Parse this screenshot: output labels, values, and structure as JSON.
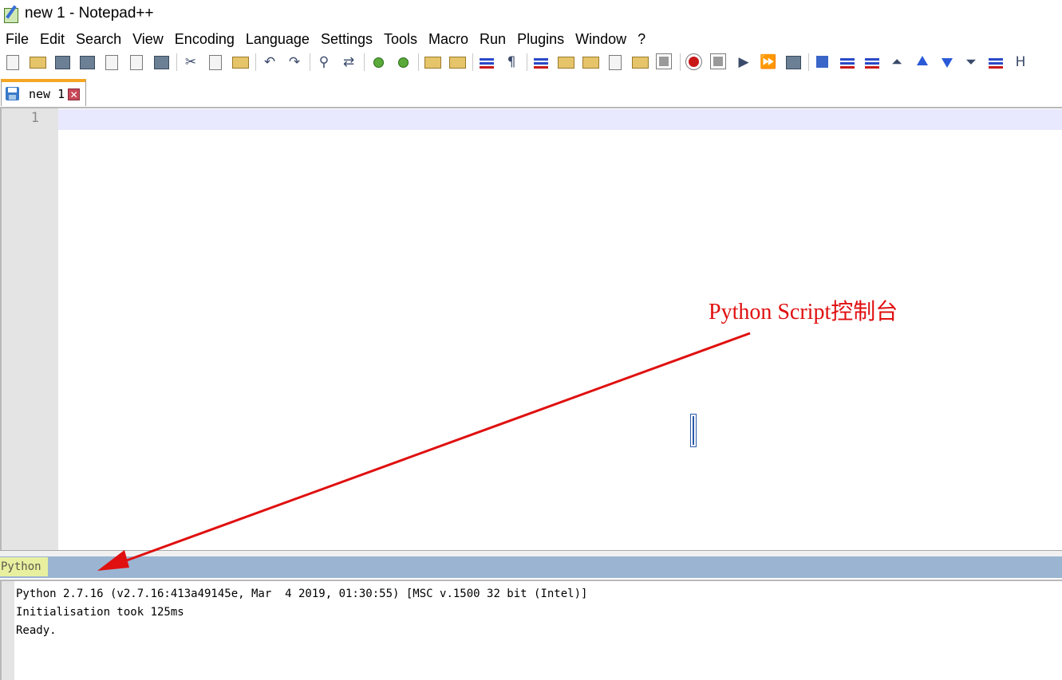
{
  "window": {
    "title": "new 1 - Notepad++"
  },
  "menu": [
    "File",
    "Edit",
    "Search",
    "View",
    "Encoding",
    "Language",
    "Settings",
    "Tools",
    "Macro",
    "Run",
    "Plugins",
    "Window",
    "?"
  ],
  "toolbar": {
    "buttons": [
      {
        "name": "new-file-icon",
        "style": "a",
        "group": 1
      },
      {
        "name": "open-file-icon",
        "style": "c",
        "group": 1
      },
      {
        "name": "save-icon",
        "style": "b",
        "group": 1
      },
      {
        "name": "save-all-icon",
        "style": "b",
        "group": 1
      },
      {
        "name": "close-icon",
        "style": "a",
        "group": 1
      },
      {
        "name": "close-all-icon",
        "style": "a",
        "group": 1
      },
      {
        "name": "print-icon",
        "style": "b",
        "group": 1
      },
      {
        "name": "cut-icon",
        "glyph": "✂",
        "group": 2
      },
      {
        "name": "copy-icon",
        "style": "a",
        "group": 2
      },
      {
        "name": "paste-icon",
        "style": "c",
        "group": 2
      },
      {
        "name": "undo-icon",
        "glyph": "↶",
        "group": 3
      },
      {
        "name": "redo-icon",
        "glyph": "↷",
        "group": 3
      },
      {
        "name": "find-icon",
        "glyph": "⚲",
        "group": 4
      },
      {
        "name": "replace-icon",
        "glyph": "⇄",
        "group": 4
      },
      {
        "name": "zoom-in-icon",
        "style": "d",
        "group": 5
      },
      {
        "name": "zoom-out-icon",
        "style": "d",
        "group": 5
      },
      {
        "name": "sync-vertical-icon",
        "style": "c",
        "group": 6
      },
      {
        "name": "sync-horizontal-icon",
        "style": "c",
        "group": 6
      },
      {
        "name": "word-wrap-icon",
        "style": "h",
        "group": 7
      },
      {
        "name": "show-all-chars-icon",
        "glyph": "¶",
        "group": 7
      },
      {
        "name": "indent-guide-icon",
        "style": "h",
        "group": 8
      },
      {
        "name": "user-language-icon",
        "style": "c",
        "group": 8
      },
      {
        "name": "document-map-icon",
        "style": "c",
        "group": 8
      },
      {
        "name": "function-list-icon",
        "style": "a",
        "group": 8
      },
      {
        "name": "folder-as-workspace-icon",
        "style": "c",
        "group": 8
      },
      {
        "name": "monitoring-icon",
        "style": "g",
        "group": 8
      },
      {
        "name": "record-macro-icon",
        "style": "f",
        "group": 9
      },
      {
        "name": "stop-recording-icon",
        "style": "g",
        "group": 9
      },
      {
        "name": "playback-macro-icon",
        "glyph": "▶",
        "group": 9
      },
      {
        "name": "run-macro-multiple-icon",
        "glyph": "⏩",
        "group": 9
      },
      {
        "name": "save-macro-icon",
        "style": "b",
        "group": 9
      },
      {
        "name": "python-script-run-icon",
        "style": "e",
        "group": 10
      },
      {
        "name": "columns-icon",
        "style": "h",
        "group": 10
      },
      {
        "name": "columns-alt-icon",
        "style": "h",
        "group": 10
      },
      {
        "name": "collapse-icon",
        "glyph": "⏶",
        "group": 10
      },
      {
        "name": "move-up-icon",
        "style": "i",
        "group": 10
      },
      {
        "name": "move-down-icon",
        "style": "j",
        "group": 10
      },
      {
        "name": "expand-icon",
        "glyph": "⏷",
        "group": 10
      },
      {
        "name": "panel-icon",
        "style": "h",
        "group": 10
      },
      {
        "name": "hex-editor-icon",
        "glyph": "H",
        "group": 10
      }
    ]
  },
  "tab": {
    "label": "new 1",
    "close_glyph": "✕"
  },
  "editor": {
    "line_number": "1"
  },
  "annotation": {
    "text": "Python Script控制台",
    "color": "#e01010"
  },
  "console": {
    "title": "Python",
    "lines": [
      "Python 2.7.16 (v2.7.16:413a49145e, Mar  4 2019, 01:30:55) [MSC v.1500 32 bit (Intel)]",
      "Initialisation took 125ms",
      "Ready."
    ]
  }
}
